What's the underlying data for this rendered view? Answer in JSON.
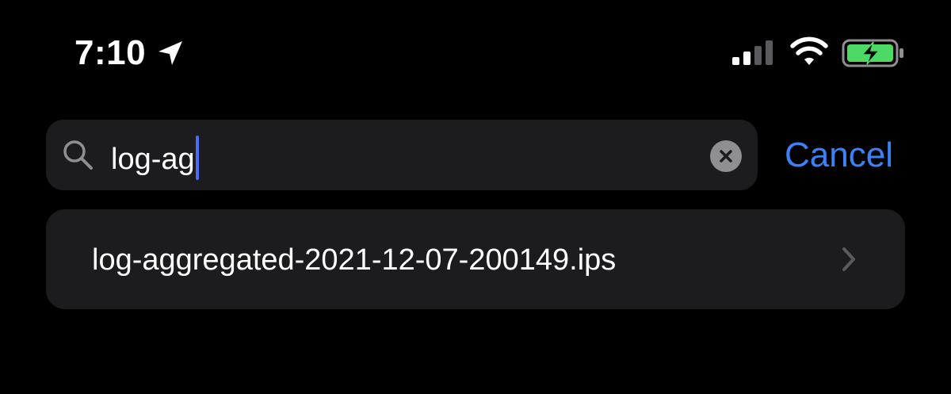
{
  "status_bar": {
    "time": "7:10",
    "icons": [
      "location-arrow-icon",
      "cellular-signal-icon",
      "wifi-icon",
      "battery-charging-icon"
    ],
    "signal_bars_active": 2,
    "signal_bars_total": 4
  },
  "search": {
    "query": "log-ag",
    "icon": "search-icon",
    "clear_icon": "clear-icon",
    "cancel_label": "Cancel"
  },
  "results": [
    {
      "label": "log-aggregated-2021-12-07-200149.ips",
      "icon": "chevron-right-icon"
    }
  ],
  "colors": {
    "background": "#000000",
    "field_background": "#1c1c1e",
    "accent": "#3a82f7",
    "caret": "#4a6cf7",
    "battery_fill": "#4cd964"
  }
}
